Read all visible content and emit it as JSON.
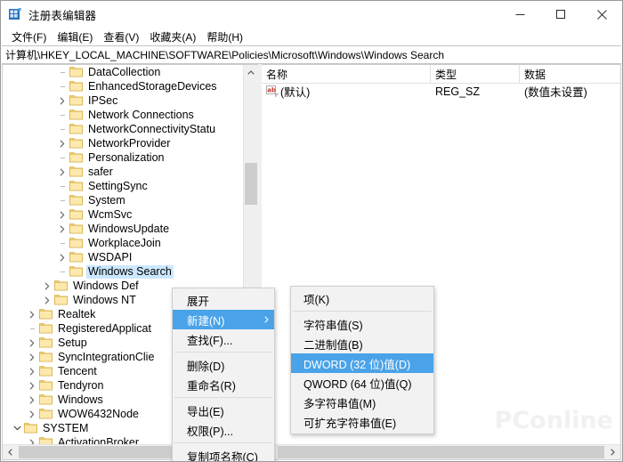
{
  "window": {
    "title": "注册表编辑器",
    "icon": "registry-editor-icon",
    "minimize_label": "−",
    "maximize_label": "□",
    "close_label": "✕"
  },
  "menubar": {
    "items": [
      {
        "label": "文件(F)",
        "name": "menu-file"
      },
      {
        "label": "编辑(E)",
        "name": "menu-edit"
      },
      {
        "label": "查看(V)",
        "name": "menu-view"
      },
      {
        "label": "收藏夹(A)",
        "name": "menu-favorites"
      },
      {
        "label": "帮助(H)",
        "name": "menu-help"
      }
    ]
  },
  "address": {
    "path": "计算机\\HKEY_LOCAL_MACHINE\\SOFTWARE\\Policies\\Microsoft\\Windows\\Windows Search"
  },
  "tree": {
    "items": [
      {
        "label": "DataCollection",
        "indent": 3,
        "expander": "none",
        "selected": false
      },
      {
        "label": "EnhancedStorageDevices",
        "indent": 3,
        "expander": "none",
        "selected": false
      },
      {
        "label": "IPSec",
        "indent": 3,
        "expander": "collapsed",
        "selected": false
      },
      {
        "label": "Network Connections",
        "indent": 3,
        "expander": "none",
        "selected": false
      },
      {
        "label": "NetworkConnectivityStatu",
        "indent": 3,
        "expander": "none",
        "selected": false
      },
      {
        "label": "NetworkProvider",
        "indent": 3,
        "expander": "collapsed",
        "selected": false
      },
      {
        "label": "Personalization",
        "indent": 3,
        "expander": "none",
        "selected": false
      },
      {
        "label": "safer",
        "indent": 3,
        "expander": "collapsed",
        "selected": false
      },
      {
        "label": "SettingSync",
        "indent": 3,
        "expander": "none",
        "selected": false
      },
      {
        "label": "System",
        "indent": 3,
        "expander": "none",
        "selected": false
      },
      {
        "label": "WcmSvc",
        "indent": 3,
        "expander": "collapsed",
        "selected": false
      },
      {
        "label": "WindowsUpdate",
        "indent": 3,
        "expander": "collapsed",
        "selected": false
      },
      {
        "label": "WorkplaceJoin",
        "indent": 3,
        "expander": "none",
        "selected": false
      },
      {
        "label": "WSDAPI",
        "indent": 3,
        "expander": "collapsed",
        "selected": false
      },
      {
        "label": "Windows Search",
        "indent": 3,
        "expander": "none",
        "selected": true
      },
      {
        "label": "Windows Def",
        "indent": 2,
        "expander": "collapsed",
        "selected": false
      },
      {
        "label": "Windows NT",
        "indent": 2,
        "expander": "collapsed",
        "selected": false
      },
      {
        "label": "Realtek",
        "indent": 1,
        "expander": "collapsed",
        "selected": false
      },
      {
        "label": "RegisteredApplicat",
        "indent": 1,
        "expander": "none",
        "selected": false
      },
      {
        "label": "Setup",
        "indent": 1,
        "expander": "collapsed",
        "selected": false
      },
      {
        "label": "SyncIntegrationClie",
        "indent": 1,
        "expander": "collapsed",
        "selected": false
      },
      {
        "label": "Tencent",
        "indent": 1,
        "expander": "collapsed",
        "selected": false
      },
      {
        "label": "Tendyron",
        "indent": 1,
        "expander": "collapsed",
        "selected": false
      },
      {
        "label": "Windows",
        "indent": 1,
        "expander": "collapsed",
        "selected": false
      },
      {
        "label": "WOW6432Node",
        "indent": 1,
        "expander": "collapsed",
        "selected": false
      },
      {
        "label": "SYSTEM",
        "indent": 0,
        "expander": "expanded",
        "selected": false
      },
      {
        "label": "ActivationBroker",
        "indent": 1,
        "expander": "collapsed",
        "selected": false
      }
    ]
  },
  "values": {
    "columns": [
      {
        "label": "名称",
        "name": "column-name"
      },
      {
        "label": "类型",
        "name": "column-type"
      },
      {
        "label": "数据",
        "name": "column-data"
      }
    ],
    "rows": [
      {
        "name": "(默认)",
        "type": "REG_SZ",
        "data": "(数值未设置)",
        "icon": "string-value-icon"
      }
    ]
  },
  "context_menu": {
    "items": [
      {
        "label": "展开",
        "name": "ctx-expand",
        "highlight": false,
        "submenu": false,
        "separator_after": false
      },
      {
        "label": "新建(N)",
        "name": "ctx-new",
        "highlight": true,
        "submenu": true,
        "separator_after": false
      },
      {
        "label": "查找(F)...",
        "name": "ctx-find",
        "highlight": false,
        "submenu": false,
        "separator_after": true
      },
      {
        "label": "删除(D)",
        "name": "ctx-delete",
        "highlight": false,
        "submenu": false,
        "separator_after": false
      },
      {
        "label": "重命名(R)",
        "name": "ctx-rename",
        "highlight": false,
        "submenu": false,
        "separator_after": true
      },
      {
        "label": "导出(E)",
        "name": "ctx-export",
        "highlight": false,
        "submenu": false,
        "separator_after": false
      },
      {
        "label": "权限(P)...",
        "name": "ctx-permissions",
        "highlight": false,
        "submenu": false,
        "separator_after": true
      },
      {
        "label": "复制项名称(C)",
        "name": "ctx-copy-key-name",
        "highlight": false,
        "submenu": false,
        "separator_after": false
      }
    ]
  },
  "submenu": {
    "items": [
      {
        "label": "项(K)",
        "name": "submenu-key",
        "highlight": false,
        "separator_after": true
      },
      {
        "label": "字符串值(S)",
        "name": "submenu-string-value",
        "highlight": false,
        "separator_after": false
      },
      {
        "label": "二进制值(B)",
        "name": "submenu-binary-value",
        "highlight": false,
        "separator_after": false
      },
      {
        "label": "DWORD (32 位)值(D)",
        "name": "submenu-dword-value",
        "highlight": true,
        "separator_after": false
      },
      {
        "label": "QWORD (64 位)值(Q)",
        "name": "submenu-qword-value",
        "highlight": false,
        "separator_after": false
      },
      {
        "label": "多字符串值(M)",
        "name": "submenu-multi-string",
        "highlight": false,
        "separator_after": false
      },
      {
        "label": "可扩充字符串值(E)",
        "name": "submenu-expandable-string",
        "highlight": false,
        "separator_after": false
      }
    ]
  },
  "watermark": {
    "text": "PConline"
  },
  "colors": {
    "selection": "#cce8ff",
    "menu_highlight": "#4aa3e8",
    "folder": "#fbd97b",
    "window_bg": "#ffffff",
    "scrollbar_track": "#f0f0f0",
    "scrollbar_thumb": "#cdcdcd"
  }
}
